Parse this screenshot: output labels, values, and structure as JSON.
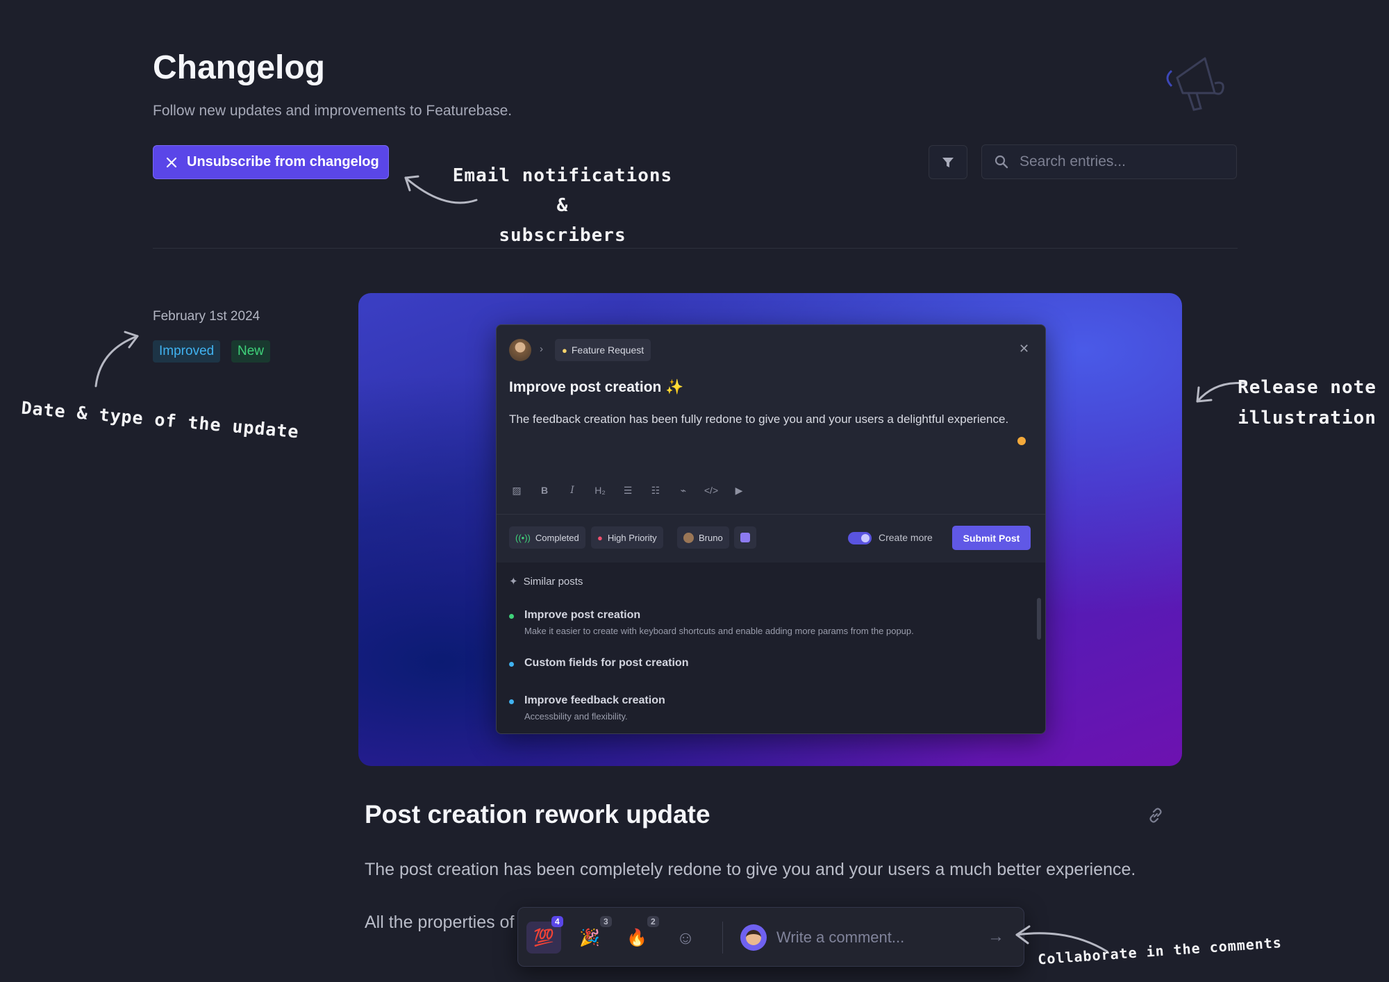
{
  "header": {
    "title": "Changelog",
    "subtitle": "Follow new updates and improvements to Featurebase.",
    "unsubscribe_label": "Unsubscribe from changelog",
    "search_placeholder": "Search entries..."
  },
  "annotations": {
    "email": "Email notifications &\nsubscribers",
    "date_type": "Date & type of the update",
    "illustration": "Release note\nillustration",
    "comments": "Collaborate in the comments"
  },
  "entry": {
    "date": "February 1st 2024",
    "tags": [
      {
        "label": "Improved",
        "color": "#40b2f0"
      },
      {
        "label": "New",
        "color": "#3fd27a"
      }
    ],
    "title": "Post creation rework update",
    "paragraph_1": "The post creation has been completely redone to give you and your users a much better experience.",
    "paragraph_2": "All the properties of the post can now be added straight from the creation popup."
  },
  "illustration": {
    "breadcrumb_chip": "Feature Request",
    "post_title": "Improve post creation ✨",
    "post_body": "The feedback creation has been fully redone to give you and your users a delightful experience.",
    "toolbar_icons": [
      "image-icon",
      "bold-icon",
      "italic-icon",
      "heading-icon",
      "bullet-list-icon",
      "numbered-list-icon",
      "link-icon",
      "code-icon",
      "video-icon"
    ],
    "chips": {
      "status": "Completed",
      "priority": "High Priority",
      "assignee": "Bruno"
    },
    "create_more_label": "Create more",
    "submit_label": "Submit Post",
    "similar_title": "Similar posts",
    "similar_posts": [
      {
        "title": "Improve post creation",
        "desc": "Make it easier to create with keyboard shortcuts and enable adding more params from the popup.",
        "color": "#3fd27a"
      },
      {
        "title": "Custom fields for post creation",
        "desc": "",
        "color": "#40b2f0"
      },
      {
        "title": "Improve feedback creation",
        "desc": "Accessbility and flexibility.",
        "color": "#40b2f0"
      }
    ]
  },
  "comment_bar": {
    "reactions": [
      {
        "emoji": "💯",
        "count": "4"
      },
      {
        "emoji": "🎉",
        "count": "3"
      },
      {
        "emoji": "🔥",
        "count": "2"
      }
    ],
    "placeholder": "Write a comment..."
  },
  "colors": {
    "background": "#1d1f2b",
    "accent": "#5a46e8"
  }
}
